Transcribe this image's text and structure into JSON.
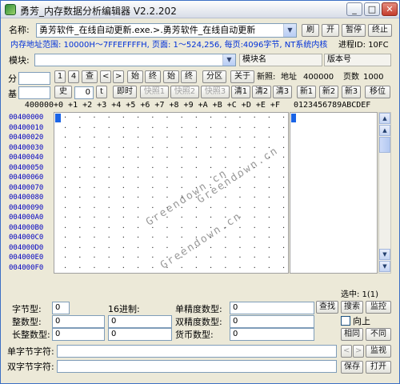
{
  "window": {
    "title": "勇芳_内存数据分析编辑器 V2.2.202"
  },
  "title_buttons": {
    "minimize": "_",
    "maximize": "□",
    "close": "✕"
  },
  "name_row": {
    "label": "名称:",
    "value": "勇芳软件_在线自动更新.exe.>.勇芳软件_在线自动更新",
    "refresh": "刷",
    "open": "开",
    "pause": "暂停",
    "terminate": "终止"
  },
  "info_row": {
    "text": "内存地址范围: 10000H～7FFEFFFFH, 页面: 1～524,256, 每页:4096字节, NT系统内核",
    "process_id": "进程ID: 10FC"
  },
  "module_row": {
    "label": "模块:",
    "module_name": "模块名",
    "version": "版本号"
  },
  "toolbar1": {
    "fen_label": "分",
    "b1": "1",
    "b4": "4",
    "find": "查",
    "prev": "<",
    "next": ">",
    "start": "始",
    "end": "终",
    "start2": "始",
    "end2": "终",
    "partition": "分区",
    "about": "关于",
    "new_label": "新照:",
    "addr_label": "地址",
    "addr_value": "400000",
    "page_label": "页数",
    "page_value": "1000"
  },
  "toolbar2": {
    "base_label": "基",
    "history": "史",
    "history_value": "0",
    "t": "t",
    "instant": "即时",
    "snap1": "快照1",
    "snap2": "快照2",
    "snap3": "快照3",
    "clear1": "清1",
    "clear2": "清2",
    "clear3": "清3",
    "new1": "新1",
    "new2": "新2",
    "new3": "新3",
    "shift": "移位"
  },
  "hex_header": {
    "address": "400000",
    "columns": "+0 +1 +2 +3 +4 +5 +6 +7 +8 +9 +A +B +C +D +E +F",
    "ascii": "0123456789ABCDEF"
  },
  "addresses": [
    "00400000",
    "00400010",
    "00400020",
    "00400030",
    "00400040",
    "00400050",
    "00400060",
    "00400070",
    "00400080",
    "00400090",
    "004000A0",
    "004000B0",
    "004000C0",
    "004000D0",
    "004000E0",
    "004000F0"
  ],
  "hex_cell": ".",
  "watermarks": [
    "Greendown.cn",
    "Greendown.cn",
    "Greendown.cn"
  ],
  "selection": {
    "label": "选中: 1(1)"
  },
  "fields": {
    "byte_label": "字节型:",
    "byte_value": "0",
    "hex16_label": "16进制:",
    "float_label": "单精度数型:",
    "float_value": "0",
    "int_label": "整数型:",
    "int_value": "0",
    "int_hex": "0",
    "double_label": "双精度数型:",
    "double_value": "0",
    "long_label": "长整数型:",
    "long_value": "0",
    "long_hex": "0",
    "currency_label": "货币数型:",
    "currency_value": "0",
    "single_str_label": "单字节字符:",
    "single_str_value": "",
    "double_str_label": "双字节字符:",
    "double_str_value": ""
  },
  "right_buttons": {
    "search": "查找",
    "search2": "搜索",
    "monitor": "监控",
    "up_label": "向上",
    "same": "相同",
    "diff": "不同",
    "left": "<",
    "right": ">",
    "monitor_view": "监视",
    "save": "保存",
    "open": "打开"
  }
}
